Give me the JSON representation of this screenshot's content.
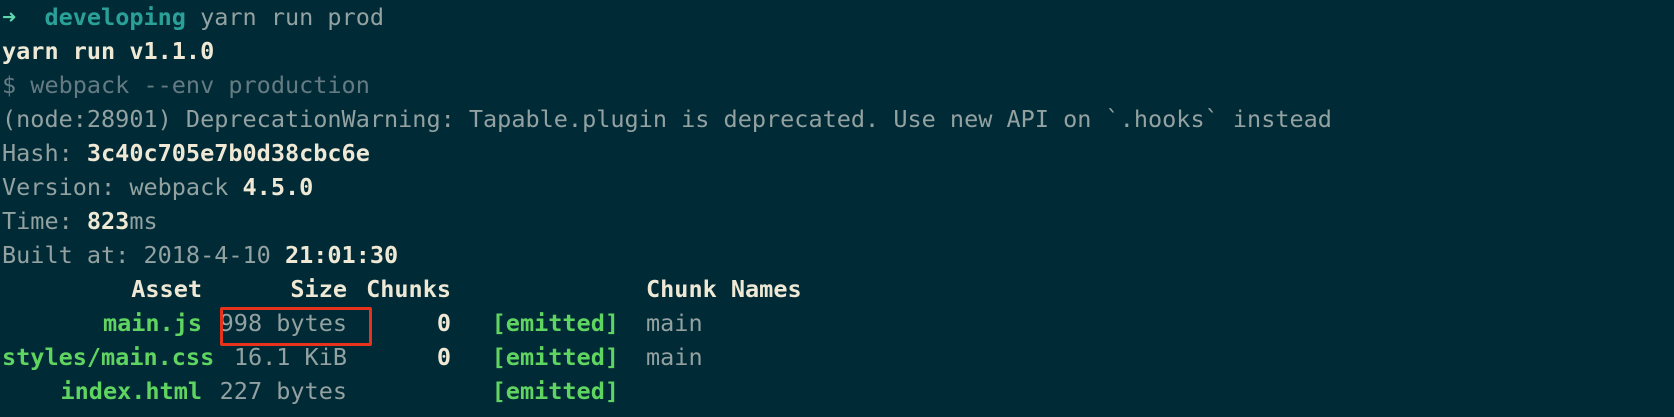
{
  "prompt": {
    "arrow": "➜",
    "dir": "developing",
    "command": "yarn run prod"
  },
  "lines": {
    "yarn_version": "yarn run v1.1.0",
    "webpack_cmd": "$ webpack --env production",
    "deprecation": "(node:28901) DeprecationWarning: Tapable.plugin is deprecated. Use new API on `.hooks` instead",
    "hash_label": "Hash: ",
    "hash_value": "3c40c705e7b0d38cbc6e",
    "version_label": "Version: webpack ",
    "version_value": "4.5.0",
    "time_label": "Time: ",
    "time_value": "823",
    "time_unit": "ms",
    "built_label": "Built at: 2018-4-10 ",
    "built_time": "21:01:30"
  },
  "table": {
    "headers": {
      "asset": "Asset",
      "size": "Size",
      "chunks": "Chunks",
      "names": "Chunk Names"
    },
    "rows": [
      {
        "asset": "main.js",
        "size": "998 bytes",
        "chunks": "0",
        "status": "[emitted]",
        "names": "main"
      },
      {
        "asset": "styles/main.css",
        "size": "16.1 KiB",
        "chunks": "0",
        "status": "[emitted]",
        "names": "main"
      },
      {
        "asset": "index.html",
        "size": "227 bytes",
        "chunks": "",
        "status": "[emitted]",
        "names": ""
      }
    ]
  },
  "colors": {
    "background": "#002b36",
    "highlight": "#e8331c",
    "asset_green": "#60d460",
    "dir_cyan": "#2aa198"
  }
}
